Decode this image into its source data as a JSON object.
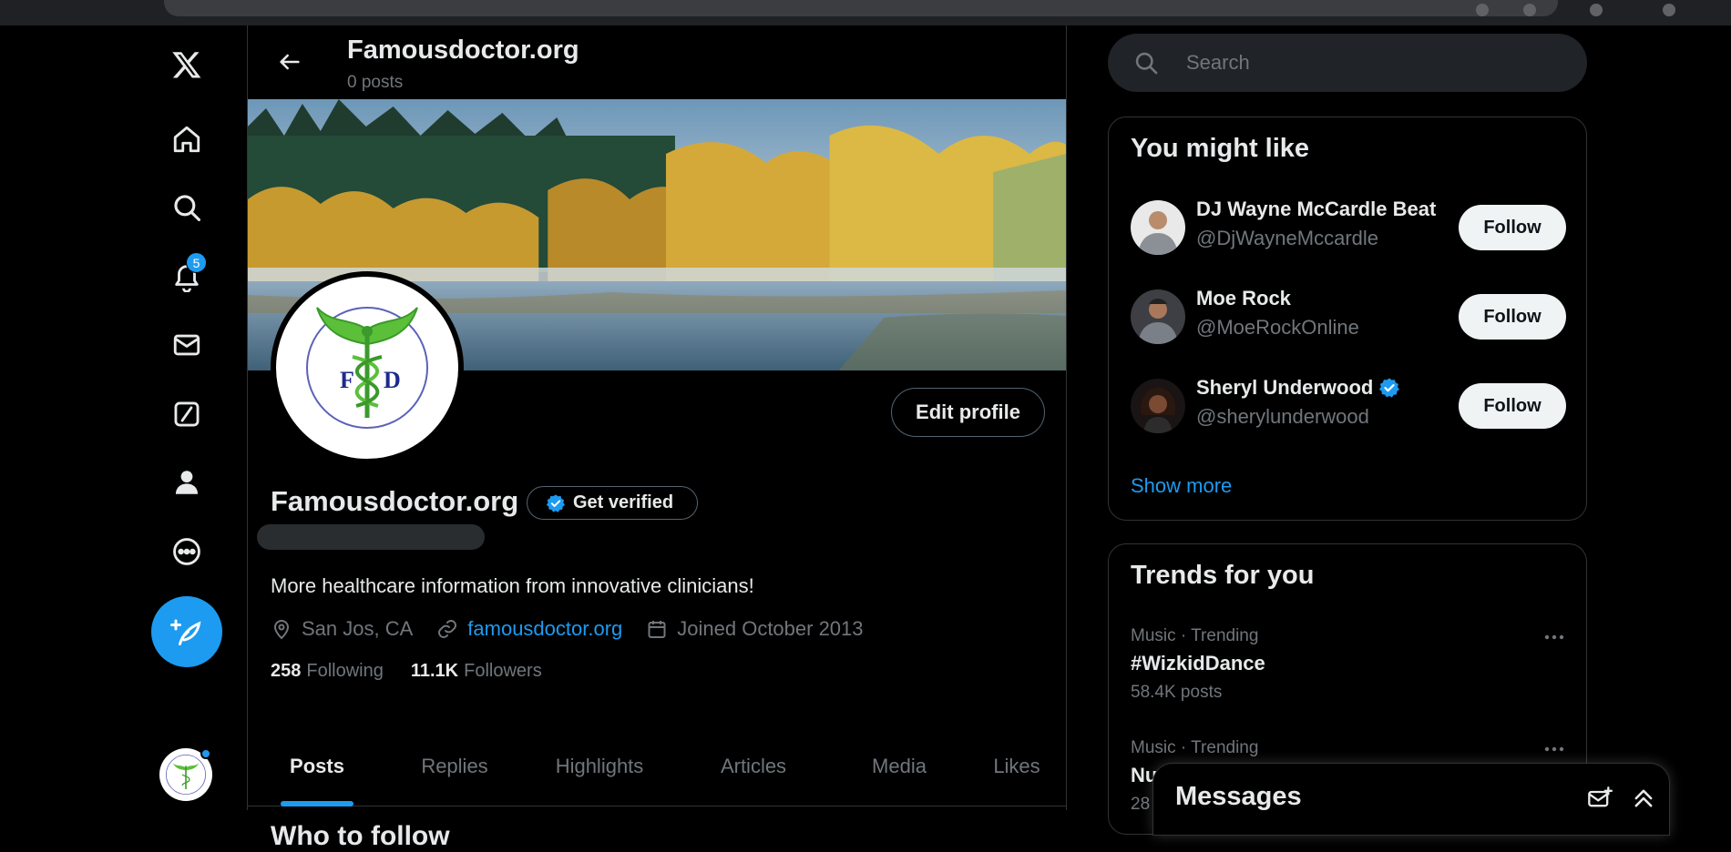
{
  "nav": {
    "notifications_count": "5"
  },
  "profile": {
    "header_title": "Famousdoctor.org",
    "header_posts": "0 posts",
    "name": "Famousdoctor.org",
    "get_verified": "Get verified",
    "edit_profile": "Edit profile",
    "bio": "More healthcare information from innovative clinicians!",
    "location": "San Jos, CA",
    "website": "famousdoctor.org",
    "joined": "Joined October 2013",
    "following_count": "258",
    "following_label": "Following",
    "followers_count": "11.1K",
    "followers_label": "Followers",
    "logo_letter_left": "F",
    "logo_letter_right": "D"
  },
  "tabs": [
    {
      "label": "Posts",
      "active": true
    },
    {
      "label": "Replies"
    },
    {
      "label": "Highlights"
    },
    {
      "label": "Articles"
    },
    {
      "label": "Media"
    },
    {
      "label": "Likes"
    }
  ],
  "below_tabs_heading": "Who to follow",
  "search": {
    "placeholder": "Search"
  },
  "you_might_like": {
    "title": "You might like",
    "follow_label": "Follow",
    "show_more": "Show more",
    "users": [
      {
        "name": "DJ Wayne McCardle Beat",
        "handle": "@DjWayneMccardle",
        "verified": false
      },
      {
        "name": "Moe Rock",
        "handle": "@MoeRockOnline",
        "verified": false
      },
      {
        "name": "Sheryl Underwood",
        "handle": "@sherylunderwood",
        "verified": true
      }
    ]
  },
  "trends": {
    "title": "Trends for you",
    "items": [
      {
        "category": "Music · Trending",
        "name": "#WizkidDance",
        "count": "58.4K posts"
      },
      {
        "category": "Music · Trending",
        "name": "Nu",
        "count": "28"
      }
    ]
  },
  "messages": {
    "title": "Messages"
  },
  "colors": {
    "accent": "#1d9bf0",
    "background": "#000000",
    "muted": "#71767b",
    "border": "#2f3336"
  }
}
